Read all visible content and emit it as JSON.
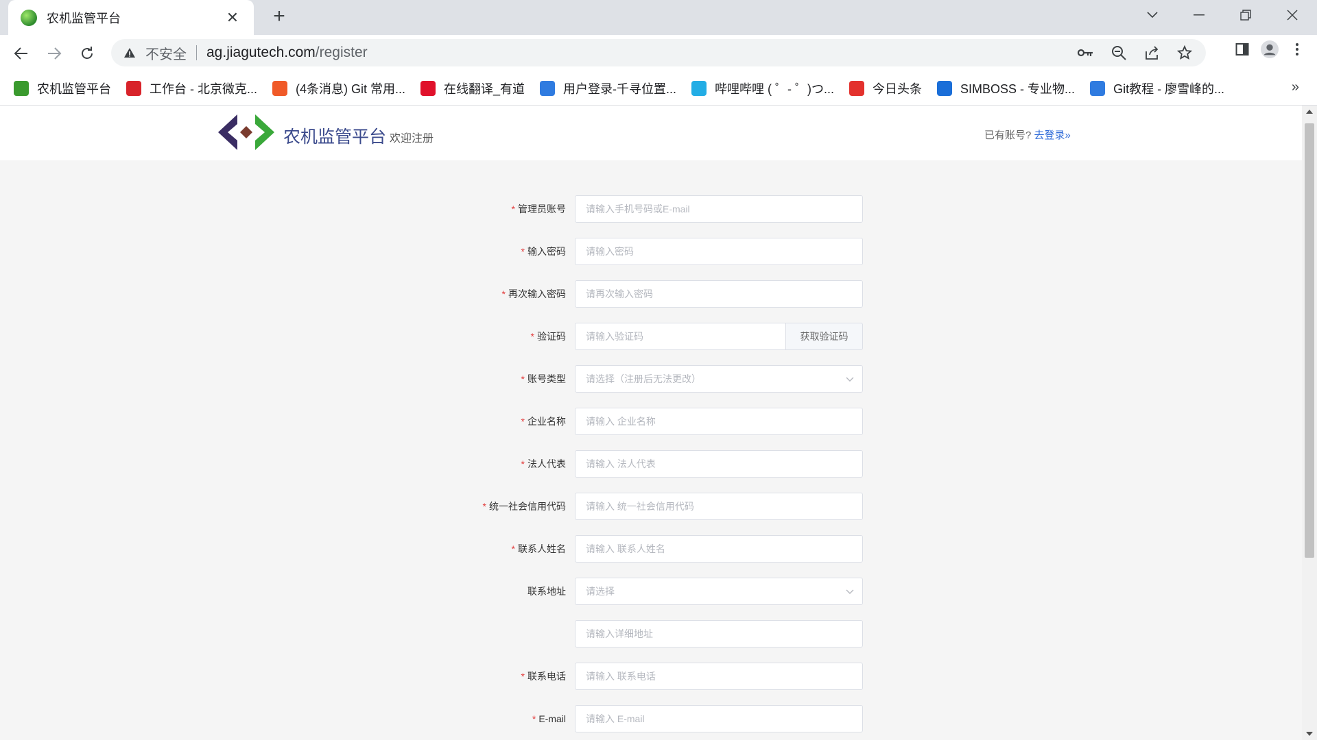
{
  "browser": {
    "tab_title": "农机监管平台",
    "new_tab": "+",
    "address_warning": "不安全",
    "url_host": "ag.jiagutech.com",
    "url_path": "/register",
    "bookmarks": [
      {
        "label": "农机监管平台",
        "color": "#3a9a2e"
      },
      {
        "label": "工作台 - 北京微克...",
        "color": "#d8232a"
      },
      {
        "label": "(4条消息) Git 常用...",
        "color": "#f05a28"
      },
      {
        "label": "在线翻译_有道",
        "color": "#e0112b"
      },
      {
        "label": "用户登录-千寻位置...",
        "color": "#2f7be0"
      },
      {
        "label": "哔哩哔哩 ( ゜- ゜)つ...",
        "color": "#23ade5"
      },
      {
        "label": "今日头条",
        "color": "#e3312d"
      },
      {
        "label": "SIMBOSS - 专业物...",
        "color": "#1a6ed8"
      },
      {
        "label": "Git教程 - 廖雪峰的...",
        "color": "#2f7be0"
      }
    ],
    "bookmarks_more": "»"
  },
  "header": {
    "brand": "农机监管平台",
    "welcome": "欢迎注册",
    "login_hint": "已有账号?",
    "login_link": "去登录»"
  },
  "form": {
    "admin_account": {
      "label": "管理员账号",
      "placeholder": "请输入手机号码或E-mail"
    },
    "password": {
      "label": "输入密码",
      "placeholder": "请输入密码"
    },
    "password_confirm": {
      "label": "再次输入密码",
      "placeholder": "请再次输入密码"
    },
    "captcha": {
      "label": "验证码",
      "placeholder": "请输入验证码",
      "button": "获取验证码"
    },
    "account_type": {
      "label": "账号类型",
      "placeholder": "请选择（注册后无法更改）"
    },
    "company_name": {
      "label": "企业名称",
      "placeholder": "请输入 企业名称"
    },
    "legal_rep": {
      "label": "法人代表",
      "placeholder": "请输入 法人代表"
    },
    "credit_code": {
      "label": "统一社会信用代码",
      "placeholder": "请输入 统一社会信用代码"
    },
    "contact_name": {
      "label": "联系人姓名",
      "placeholder": "请输入 联系人姓名"
    },
    "contact_address": {
      "label": "联系地址",
      "placeholder": "请选择"
    },
    "detail_address": {
      "placeholder": "请输入详细地址"
    },
    "contact_phone": {
      "label": "联系电话",
      "placeholder": "请输入 联系电话"
    },
    "email": {
      "label": "E-mail",
      "placeholder": "请输入 E-mail"
    },
    "required_mark": "*"
  },
  "colors": {
    "accent": "#2f6bd8",
    "brand": "#3b4a8c",
    "required": "#e23b3b"
  }
}
